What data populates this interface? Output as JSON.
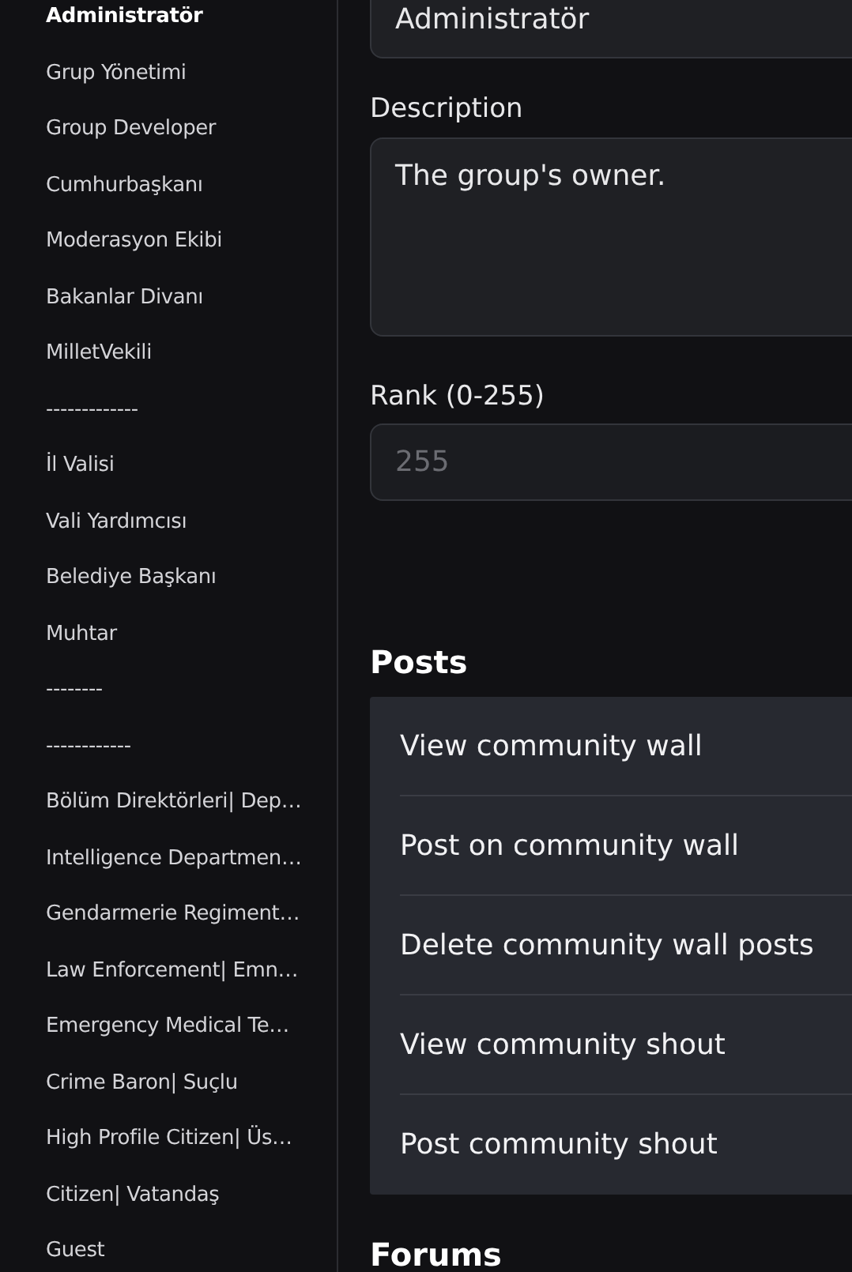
{
  "sidebar": {
    "items": [
      {
        "label": "Administratör",
        "selected": true
      },
      {
        "label": "Grup Yönetimi",
        "selected": false
      },
      {
        "label": "Group Developer",
        "selected": false
      },
      {
        "label": "Cumhurbaşkanı",
        "selected": false
      },
      {
        "label": "Moderasyon Ekibi",
        "selected": false
      },
      {
        "label": "Bakanlar Divanı",
        "selected": false
      },
      {
        "label": "MilletVekili",
        "selected": false
      },
      {
        "label": "-------------",
        "selected": false
      },
      {
        "label": "İl Valisi",
        "selected": false
      },
      {
        "label": "Vali Yardımcısı",
        "selected": false
      },
      {
        "label": "Belediye Başkanı",
        "selected": false
      },
      {
        "label": "Muhtar",
        "selected": false
      },
      {
        "label": "--------",
        "selected": false
      },
      {
        "label": "------------",
        "selected": false
      },
      {
        "label": "Bölüm Direktörleri| Dep…",
        "selected": false
      },
      {
        "label": "Intelligence Departmen…",
        "selected": false
      },
      {
        "label": "Gendarmerie Regiment…",
        "selected": false
      },
      {
        "label": "Law Enforcement| Emn…",
        "selected": false
      },
      {
        "label": "Emergency Medical Te…",
        "selected": false
      },
      {
        "label": "Crime Baron| Suçlu",
        "selected": false
      },
      {
        "label": "High Profile Citizen| Üs…",
        "selected": false
      },
      {
        "label": "Citizen| Vatandaş",
        "selected": false
      },
      {
        "label": "Guest",
        "selected": false
      }
    ]
  },
  "form": {
    "name": {
      "value": "Administratör"
    },
    "description": {
      "label": "Description",
      "value": "The group's owner."
    },
    "rank": {
      "label": "Rank (0-255)",
      "value": "255",
      "disabled": true
    }
  },
  "sections": [
    {
      "title": "Posts",
      "permissions": [
        {
          "label": "View community wall"
        },
        {
          "label": "Post on community wall"
        },
        {
          "label": "Delete community wall posts"
        },
        {
          "label": "View community shout"
        },
        {
          "label": "Post community shout"
        }
      ]
    },
    {
      "title": "Forums"
    }
  ]
}
